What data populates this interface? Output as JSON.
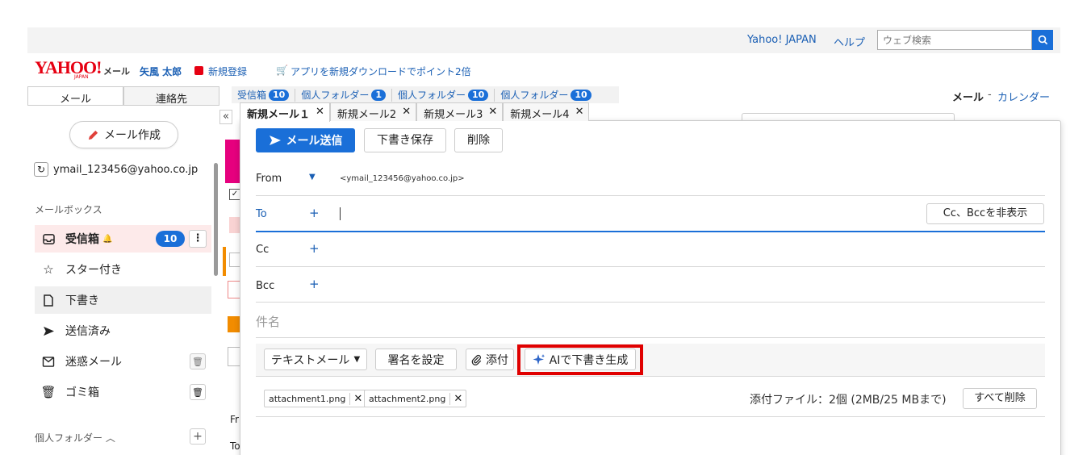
{
  "header": {
    "yahoo_japan": "Yahoo! JAPAN",
    "help": "ヘルプ",
    "search_placeholder": "ウェブ検索"
  },
  "brand": {
    "logo": "YAHOO!",
    "logo_sub": "JAPAN",
    "mail": "メール",
    "user_name": "矢風 太郎",
    "signup": "新規登録",
    "promo": "アプリを新規ダウンロードでポイント2倍"
  },
  "left_tabs": {
    "mail": "メール",
    "contacts": "連絡先"
  },
  "sidebar": {
    "compose_label": "メール作成",
    "account": "ymail_123456@yahoo.co.jp",
    "mailbox_heading": "メールボックス",
    "inbox": "受信箱",
    "inbox_count": "10",
    "starred": "スター付き",
    "drafts": "下書き",
    "sent": "送信済み",
    "spam": "迷惑メール",
    "trash": "ゴミ箱",
    "personal_folders": "個人フォルダー"
  },
  "folder_tabs": [
    {
      "label": "受信箱",
      "count": "10"
    },
    {
      "label": "個人フォルダー",
      "count": "1"
    },
    {
      "label": "個人フォルダー",
      "count": "10"
    },
    {
      "label": "個人フォルダー",
      "count": "10"
    }
  ],
  "nav": {
    "mail": "メール",
    "sep": "-",
    "calendar": "カレンダー"
  },
  "background": {
    "from_short": "Fr",
    "to_short": "To"
  },
  "compose_tabs": [
    "新規メール１",
    "新規メール2",
    "新規メール3",
    "新規メール4"
  ],
  "compose": {
    "send": "メール送信",
    "save": "下書き保存",
    "delete": "削除",
    "from_label": "From",
    "from_address": "<ymail_123456@yahoo.co.jp>",
    "to_label": "To",
    "cc_label": "Cc",
    "bcc_label": "Bcc",
    "hide_ccbcc": "Cc、Bccを非表示",
    "subject_placeholder": "件名",
    "format": "テキストメール",
    "signature": "署名を設定",
    "attach": "添付",
    "ai_draft": "AIで下書き生成",
    "attachments": [
      "attachment1.png",
      "attachment2.png"
    ],
    "attachment_info": "添付ファイル：2個 (2MB/25 MBまで)",
    "delete_all": "すべて削除"
  },
  "colors": {
    "accent": "#1a6fd8",
    "brand": "#e60012",
    "highlight": "#e00000"
  }
}
